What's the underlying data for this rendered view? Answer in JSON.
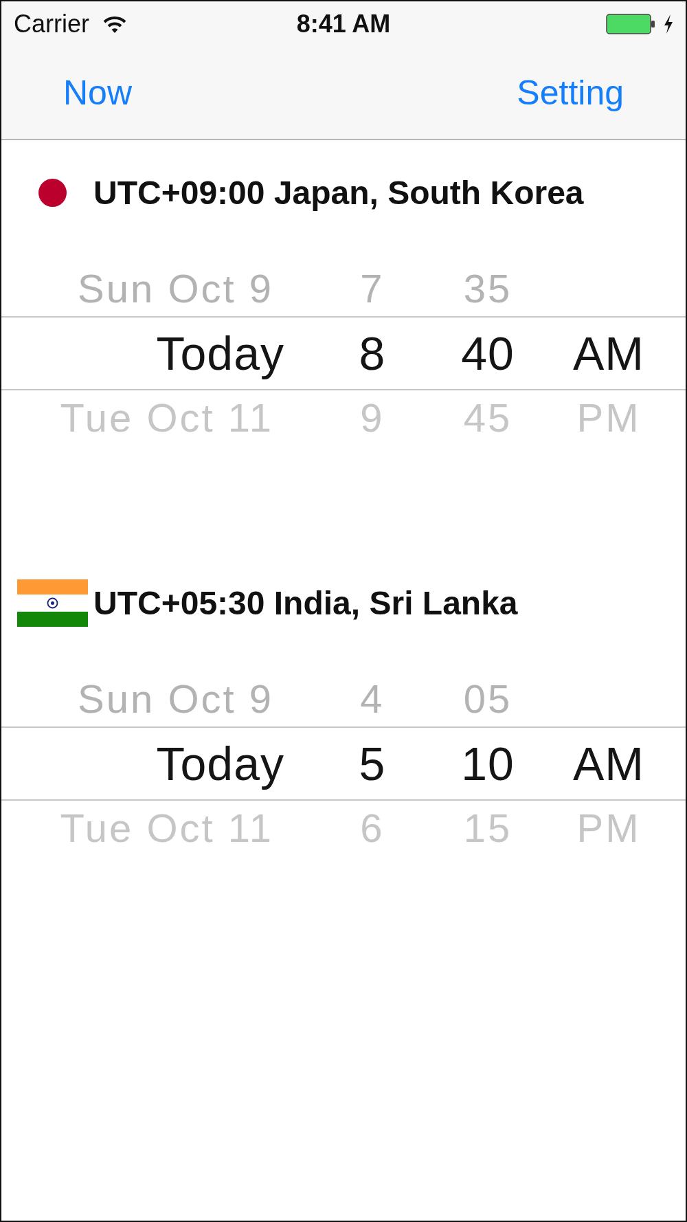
{
  "status_bar": {
    "carrier": "Carrier",
    "time": "8:41 AM",
    "charging": true
  },
  "nav_bar": {
    "left_button": "Now",
    "right_button": "Setting"
  },
  "zones": [
    {
      "kind": "dot",
      "title": "UTC+09:00 Japan, South Korea",
      "columns": [
        {
          "kind": "date",
          "items": [
            {
              "text": "Sun Oct 9",
              "selected": false
            },
            {
              "text": "Today",
              "selected": true
            },
            {
              "text": "Tue Oct 11",
              "selected": false
            }
          ]
        },
        {
          "kind": "hour",
          "items": [
            {
              "text": "7",
              "selected": false
            },
            {
              "text": "8",
              "selected": true
            },
            {
              "text": "9",
              "selected": false
            }
          ]
        },
        {
          "kind": "minute",
          "items": [
            {
              "text": "35",
              "selected": false
            },
            {
              "text": "40",
              "selected": true
            },
            {
              "text": "45",
              "selected": false
            }
          ]
        },
        {
          "kind": "period",
          "items": [
            {
              "text": "AM",
              "selected": true
            },
            {
              "text": "PM",
              "selected": false
            }
          ]
        }
      ]
    },
    {
      "kind": "flag",
      "title": "UTC+05:30 India, Sri Lanka",
      "columns": [
        {
          "kind": "date",
          "items": [
            {
              "text": "Sun Oct 9",
              "selected": false
            },
            {
              "text": "Today",
              "selected": true
            },
            {
              "text": "Tue Oct 11",
              "selected": false
            }
          ]
        },
        {
          "kind": "hour",
          "items": [
            {
              "text": "4",
              "selected": false
            },
            {
              "text": "5",
              "selected": true
            },
            {
              "text": "6",
              "selected": false
            }
          ]
        },
        {
          "kind": "minute",
          "items": [
            {
              "text": "05",
              "selected": false
            },
            {
              "text": "10",
              "selected": true
            },
            {
              "text": "15",
              "selected": false
            }
          ]
        },
        {
          "kind": "period",
          "items": [
            {
              "text": "AM",
              "selected": true
            },
            {
              "text": "PM",
              "selected": false
            }
          ]
        }
      ]
    }
  ]
}
